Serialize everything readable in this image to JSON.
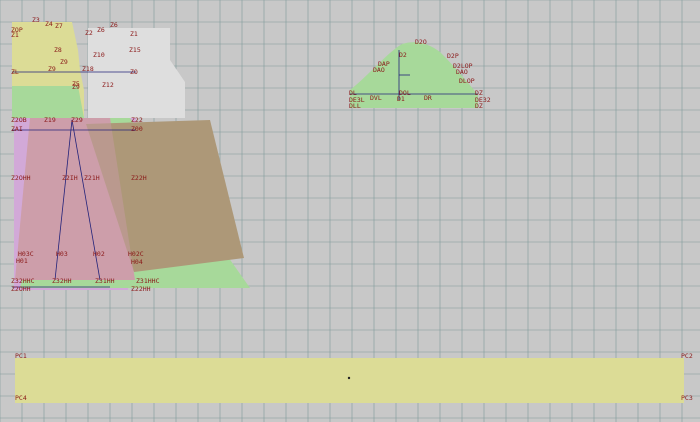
{
  "colors": {
    "background": "#c8c8c8",
    "grid": "#7f9a9a",
    "label": "#8a1818",
    "line_blue": "#23237a",
    "yellow_fill": "#dcdc96",
    "green_fill": "#a7d99a",
    "pink_fill": "#d8a2b6",
    "brown_fill": "#ad9878",
    "lilac_fill": "#d2a9d8",
    "white_piece": "#dedede"
  },
  "pieces": {
    "sleeve": {
      "labels": {
        "top": "D2O",
        "right_upper": "D2P",
        "right_upper2": "D2LOP",
        "right_mid": "DAO",
        "right_low": "DLOP",
        "left_upper": "DAP",
        "left_mid": "DAO",
        "center": "D2",
        "base_left": "DL",
        "base_left2": "DE3L",
        "base_left3": "DLL",
        "base_mid_left": "DVL",
        "base_center": "DOL",
        "base_center2": "D1",
        "base_mid_right": "DR",
        "base_right": "DZ",
        "base_right2": "DE32",
        "base_right3": "DZ"
      }
    },
    "waistband": {
      "corners": [
        "PC1",
        "PC2",
        "PC3",
        "PC4"
      ]
    },
    "bodice": {
      "labels": {
        "l_top": "ZOP",
        "l_top2": "Z1",
        "z3": "Z3",
        "z4": "Z4",
        "z7": "Z7",
        "z6a": "Z6",
        "z6b": "Z6",
        "z2a": "Z2",
        "z1b": "Z1",
        "z15": "Z15",
        "z8": "Z8",
        "z10": "Z10",
        "z9a": "Z9",
        "z18": "Z18",
        "z9b": "Z9",
        "zl": "ZL",
        "z5": "Z5",
        "zo": "ZO",
        "z12": "Z12",
        "z9c": "Z9"
      }
    },
    "skirt": {
      "labels": {
        "z20b": "Z2OB",
        "z19": "Z19",
        "z29": "Z29",
        "z22": "Z22",
        "z21": "Z21",
        "z00": "Z00",
        "zai": "ZAI",
        "z20hh": "Z2OHH",
        "z2ih": "Z2IH",
        "z21h": "Z21H",
        "z22h": "Z22H",
        "h03c": "H03C",
        "h01": "H01",
        "h03": "H03",
        "h02": "H02",
        "h02c": "H02C",
        "h04": "H04",
        "z32hhc": "Z32HHC",
        "z32hh": "Z32HH",
        "z31hh": "Z31HH",
        "z31hhc": "Z31HHC",
        "z20hh2": "Z2OHH",
        "z22hh": "Z22HH"
      }
    }
  }
}
